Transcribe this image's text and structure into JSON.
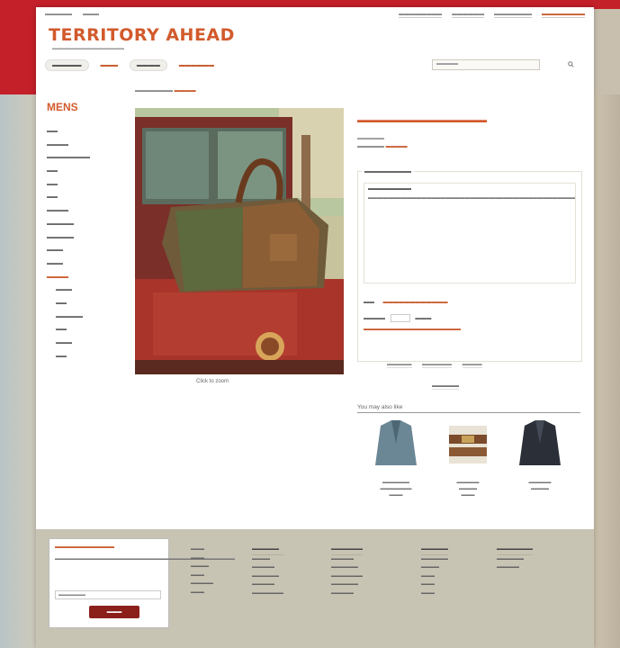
{
  "site": {
    "logo": "TERRITORY AHEAD"
  },
  "sidebar": {
    "title": "MENS"
  },
  "caption": {
    "text": "Click to zoom"
  },
  "recommendations": {
    "heading": "You may also like"
  },
  "colors": {
    "brand_red": "#c4202a",
    "accent_orange": "#d25a2c",
    "footer_bg": "#c8c4b4",
    "button_dark_red": "#8b1f1a"
  },
  "icons": {
    "search": "search-icon"
  }
}
